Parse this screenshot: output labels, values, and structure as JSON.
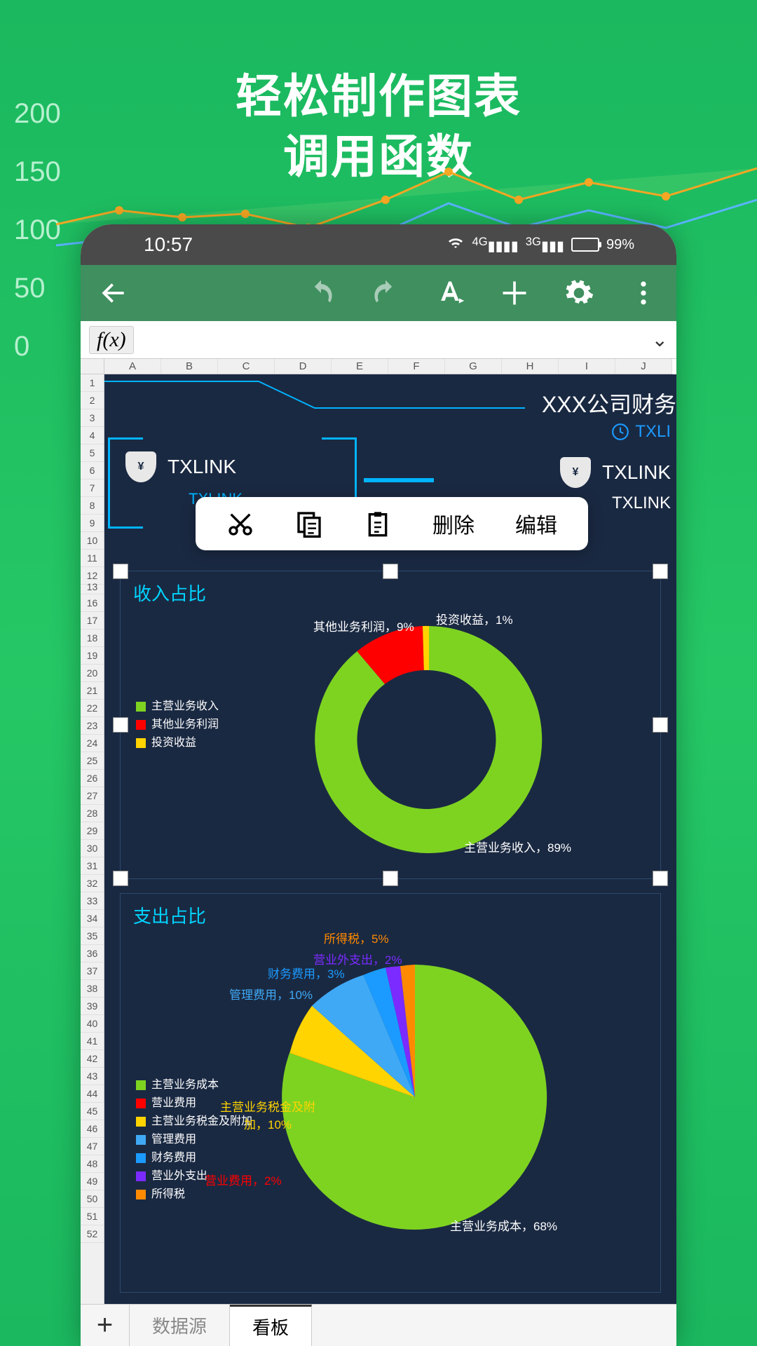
{
  "headline_line1": "轻松制作图表",
  "headline_line2": "调用函数",
  "bg_axis": [
    "200",
    "150",
    "100",
    "50",
    "0"
  ],
  "status": {
    "time": "10:57",
    "battery": "99%",
    "net1": "4G",
    "net2": "3G"
  },
  "formula_bar": {
    "fx": "f(x)"
  },
  "columns": [
    "A",
    "B",
    "C",
    "D",
    "E",
    "F",
    "G",
    "H",
    "I",
    "J"
  ],
  "rows_group1": [
    "1",
    "2",
    "3",
    "4",
    "5",
    "6",
    "7",
    "8",
    "9",
    "10",
    "11",
    "12",
    "13"
  ],
  "dash": {
    "title": "XXX公司财务",
    "tx_top": "TXLI",
    "tx_left": "TXLINK",
    "tx_left_sub": "TXLINK",
    "tx_right": "TXLINK",
    "tx_right_sub": "TXLINK",
    "money_symbol": "¥"
  },
  "context_menu": {
    "delete": "删除",
    "edit": "编辑"
  },
  "panel1": {
    "title": "收入占比",
    "labels": {
      "other_profit": "其他业务利润，9%",
      "invest": "投资收益，1%",
      "main": "主营业务收入，89%"
    },
    "legend": [
      {
        "color": "#7ed321",
        "label": "主营业务收入"
      },
      {
        "color": "#ff0000",
        "label": "其他业务利润"
      },
      {
        "color": "#ffd400",
        "label": "投资收益"
      }
    ]
  },
  "panel2": {
    "title": "支出占比",
    "labels": {
      "income_tax": "所得税，5%",
      "nonop": "营业外支出，2%",
      "finance": "财务费用，3%",
      "mgmt": "管理费用，10%",
      "tax_add": "主营业务税金及附加，10%",
      "op_cost": "营业费用，2%",
      "main_cost": "主营业务成本，68%"
    },
    "legend": [
      {
        "color": "#7ed321",
        "label": "主营业务成本"
      },
      {
        "color": "#ff0000",
        "label": "营业费用"
      },
      {
        "color": "#ffd400",
        "label": "主营业务税金及附加"
      },
      {
        "color": "#3fa9f5",
        "label": "管理费用"
      },
      {
        "color": "#1b9bff",
        "label": "财务费用"
      },
      {
        "color": "#7b2bff",
        "label": "营业外支出"
      },
      {
        "color": "#ff8a00",
        "label": "所得税"
      }
    ]
  },
  "tabs": {
    "source": "数据源",
    "board": "看板"
  },
  "chart_data": [
    {
      "type": "pie",
      "title": "收入占比",
      "series": [
        {
          "name": "主营业务收入",
          "value": 89,
          "color": "#7ed321"
        },
        {
          "name": "其他业务利润",
          "value": 9,
          "color": "#ff0000"
        },
        {
          "name": "投资收益",
          "value": 1,
          "color": "#ffd400"
        }
      ],
      "donut": true
    },
    {
      "type": "pie",
      "title": "支出占比",
      "series": [
        {
          "name": "主营业务成本",
          "value": 68,
          "color": "#7ed321"
        },
        {
          "name": "营业费用",
          "value": 2,
          "color": "#ff0000"
        },
        {
          "name": "主营业务税金及附加",
          "value": 10,
          "color": "#ffd400"
        },
        {
          "name": "管理费用",
          "value": 10,
          "color": "#3fa9f5"
        },
        {
          "name": "财务费用",
          "value": 3,
          "color": "#1b9bff"
        },
        {
          "name": "营业外支出",
          "value": 2,
          "color": "#7b2bff"
        },
        {
          "name": "所得税",
          "value": 5,
          "color": "#ff8a00"
        }
      ],
      "donut": false
    }
  ]
}
